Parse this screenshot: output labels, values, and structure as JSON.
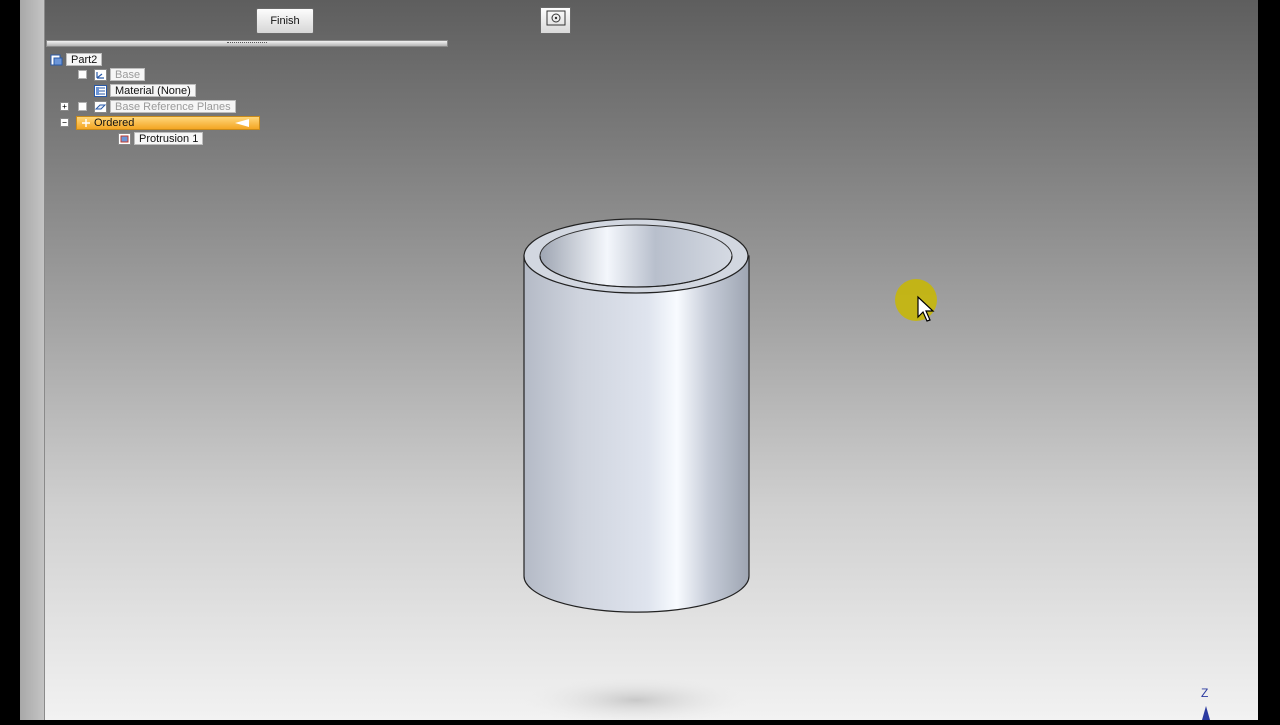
{
  "toolbar": {
    "finish_label": "Finish",
    "view_icon": "target-view-icon"
  },
  "tree": {
    "root": {
      "label": "Part2",
      "icon": "part-icon"
    },
    "base": {
      "label": "Base",
      "icon": "coordinate-system-icon"
    },
    "material": {
      "label": "Material (None)",
      "icon": "material-table-icon"
    },
    "ref_planes": {
      "label": "Base Reference Planes",
      "icon": "reference-plane-icon"
    },
    "ordered": {
      "label": "Ordered",
      "icon": "ordered-icon"
    },
    "protrusion": {
      "label": "Protrusion 1",
      "icon": "protrusion-icon"
    }
  },
  "axis": {
    "z_label": "Z"
  },
  "colors": {
    "ordered_highlight": "#f4a623",
    "cursor_halo": "#c9b800"
  }
}
